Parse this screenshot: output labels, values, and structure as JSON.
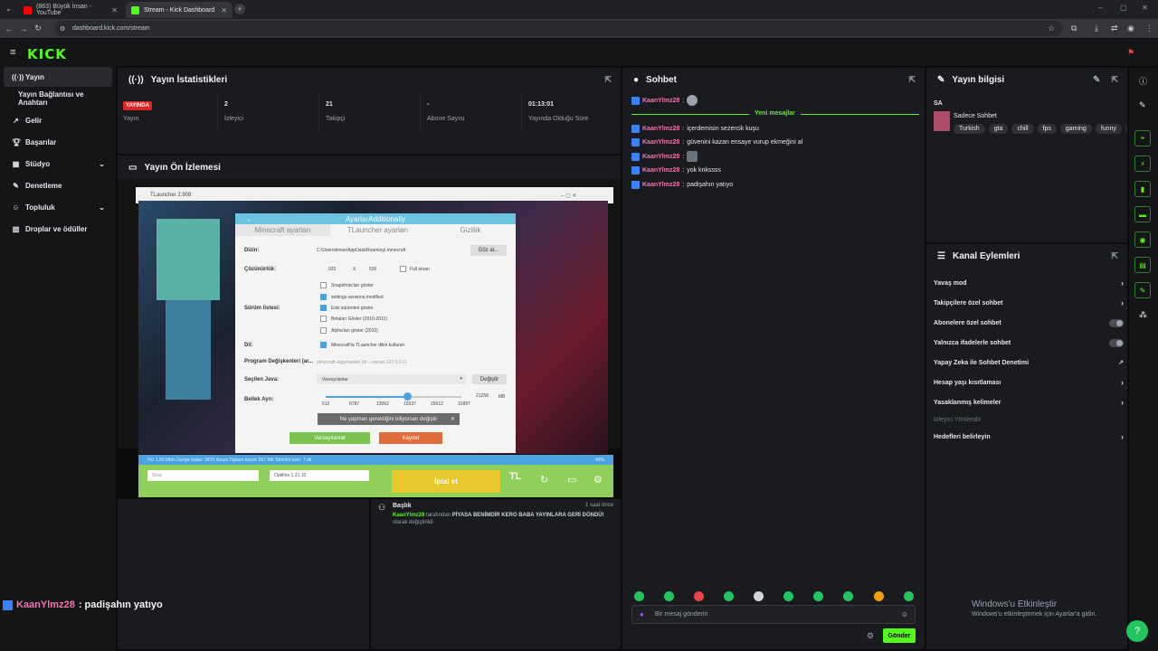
{
  "browser": {
    "tabs": [
      {
        "title": "(863) Büyük İnsan - YouTube",
        "active": false,
        "color": "#ff0000"
      },
      {
        "title": "Stream - Kick Dashboard",
        "active": true,
        "color": "#53fc18"
      }
    ],
    "url": "dashboard.kick.com/stream"
  },
  "app": {
    "logo": "KICK"
  },
  "sidebar": {
    "items": [
      {
        "label": "Yayın",
        "icon": "broadcast-icon",
        "active": true
      },
      {
        "label": "Yayın Bağlantısı ve Anahtarı",
        "icon": "",
        "active": false
      },
      {
        "label": "Gelir",
        "icon": "wrench-icon",
        "active": false
      },
      {
        "label": "Başarılar",
        "icon": "trophy-icon",
        "active": false
      },
      {
        "label": "Stüdyo",
        "icon": "grid-icon",
        "active": false,
        "chevron": true
      },
      {
        "label": "Denetleme",
        "icon": "wrench-icon",
        "active": false
      },
      {
        "label": "Topluluk",
        "icon": "community-icon",
        "active": false,
        "chevron": true
      },
      {
        "label": "Droplar ve ödüller",
        "icon": "gift-icon",
        "active": false
      }
    ]
  },
  "stats": {
    "title": "Yayın İstatistikleri",
    "live_badge": "YAYINDA",
    "items": [
      {
        "value": "",
        "label": "Yayın"
      },
      {
        "value": "2",
        "label": "İzleyici"
      },
      {
        "value": "21",
        "label": "Takipçi"
      },
      {
        "value": "-",
        "label": "Abone Sayısı"
      },
      {
        "value": "01:13:01",
        "label": "Yayında Olduğu Süre"
      }
    ]
  },
  "preview": {
    "title": "Yayın Ön İzlemesi",
    "tlauncher": {
      "window_title": "TLauncher 2.908",
      "dialog_title": "AyarlarAdditionally",
      "tabs": [
        "Minecraft ayarları",
        "TLauncher ayarları",
        "Gizlilik"
      ],
      "dir_label": "Dizin:",
      "dir_value": "C:\\Users\\kmse\\AppData\\Roaming\\.minecraft",
      "dir_button": "Göz at...",
      "res_label": "Çözünürlük:",
      "res_w": "925",
      "res_x": "X",
      "res_h": "530",
      "fullscreen": "Full ekran",
      "version_label": "Sürüm listesi:",
      "checkboxes": [
        {
          "label": "Snapshots'ları göster",
          "on": false
        },
        {
          "label": "settings.versions.modified",
          "on": true
        },
        {
          "label": "Eski sürümleri göster",
          "on": true
        },
        {
          "label": "Betaları Göster (2010-2011)",
          "on": false
        },
        {
          "label": "Alpha'ları göster (2010)",
          "on": false
        }
      ],
      "lang_label": "Dil:",
      "lang_value": "Minecraft'ta TLauncher dilini kullanın",
      "args_label": "Program Değişkenleri (ar...",
      "args_value": "minecraft argumanlari (ör. --server 127.0.0.1)",
      "java_label": "Seçilen Java:",
      "java_value": "Varsayılanlar",
      "java_button": "Değiştir",
      "mem_label": "Bellek Ayrı:",
      "mem_value": "21258",
      "mem_unit": "MB",
      "mem_ticks": [
        "512",
        "6787",
        "13062",
        "19337",
        "25612",
        "31887"
      ],
      "mem_fill": 0.6,
      "hint": "Ne yapman gerektiğini biliyorsan değiştir",
      "defaults_button": "Varsayılanlar",
      "save_button": "Kaydet",
      "status": "Hız 1.90 Mb/s  Geriye kalan: 2870 dosya  Toplam boyut: 567 Mb  Tahmini süre: 7 dk",
      "progress": "40%",
      "username": "Sirax",
      "version": "Optifine 1.21.10",
      "cancel": "İptal et",
      "tl_logo": "TL"
    }
  },
  "activity": {
    "title": "Başlık",
    "time": "1 saat önce",
    "user": "KaanYlmz28",
    "text_before": " tarafından ",
    "new_title": "PİYASA BENİMDİR KERO BABA YAYINLARA GERİ DÖNDÜ!",
    "text_after": " olarak değiştirildi"
  },
  "chat": {
    "title": "Sohbet",
    "new_messages": "Yeni mesajlar",
    "messages_top": [
      {
        "user": "KaanYlmz28",
        "text": "",
        "emote": true
      }
    ],
    "messages": [
      {
        "user": "KaanYlmz28",
        "text": "içerdemisin sezercik kuşu",
        "emote": false
      },
      {
        "user": "KaanYlmz28",
        "text": "güvenini kazan ensaye vurup ekmeğini al",
        "emote": false
      },
      {
        "user": "KaanYlmz28",
        "text": "",
        "emote": true
      },
      {
        "user": "KaanYlmz28",
        "text": "yok knkssss",
        "emote": false
      },
      {
        "user": "KaanYlmz28",
        "text": "padişahın yatıyo",
        "emote": false
      }
    ],
    "input_placeholder": "Bir mesaj gönderin",
    "send": "Gönder"
  },
  "stream_info": {
    "title": "Yayın bilgisi",
    "stream_title": "SA",
    "category": "Sadece Sohbet",
    "tags": [
      "Turkish",
      "gta",
      "chill",
      "fps",
      "gaming",
      "funny",
      "yo"
    ]
  },
  "channel_actions": {
    "title": "Kanal Eylemleri",
    "items": [
      {
        "label": "Yavaş mod",
        "kind": "chevron"
      },
      {
        "label": "Takipçilere özel sohbet",
        "kind": "chevron"
      },
      {
        "label": "Abonelere özel sohbet",
        "kind": "toggle"
      },
      {
        "label": "Yalnızca ifadelerle sohbet",
        "kind": "toggle"
      },
      {
        "label": "Yapay Zeka ile Sohbet Denetimi",
        "kind": "external"
      },
      {
        "label": "Hesap yaşı kısıtlaması",
        "kind": "chevron"
      },
      {
        "label": "Yasaklanmış kelimeler",
        "kind": "chevron"
      },
      {
        "label": "İzleyici Yönlendir",
        "kind": "disabled"
      },
      {
        "label": "Hedefleri belirleyin",
        "kind": "chevron"
      }
    ]
  },
  "windows": {
    "title": "Windows'u Etkinleştir",
    "subtitle": "Windows'u etkinleştirmek için Ayarlar'a gidin."
  },
  "overlay": {
    "user": "KaanYlmz28",
    "text": " : padişahın yatıyo"
  }
}
